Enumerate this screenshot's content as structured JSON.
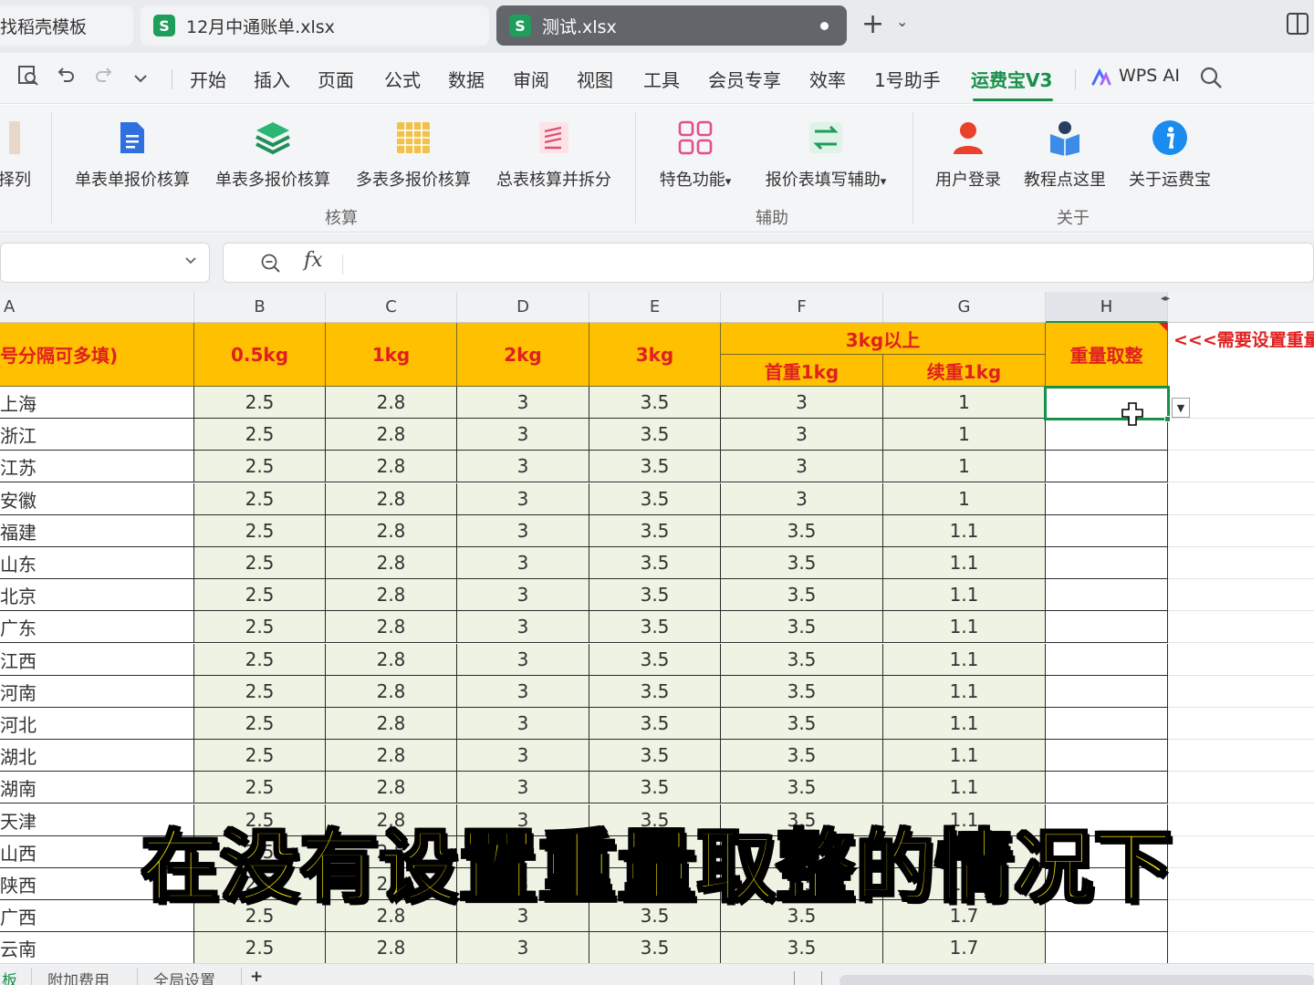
{
  "tabs": [
    {
      "label": "找稻壳模板",
      "icon": ""
    },
    {
      "label": "12月中通账单.xlsx",
      "icon": "S"
    },
    {
      "label": "测试.xlsx",
      "icon": "S"
    }
  ],
  "menu": [
    "开始",
    "插入",
    "页面",
    "公式",
    "数据",
    "审阅",
    "视图",
    "工具",
    "会员专享",
    "效率",
    "1号助手",
    "运费宝V3"
  ],
  "menu_active": "运费宝V3",
  "wps_ai": "WPS AI",
  "ribbon": {
    "left_cut": "择列",
    "buttons": [
      "单表单报价核算",
      "单表多报价核算",
      "多表多报价核算",
      "总表核算并拆分",
      "特色功能",
      "报价表填写辅助",
      "用户登录",
      "教程点这里",
      "关于运费宝"
    ],
    "dropdown_mark": "▾",
    "groups": [
      "核算",
      "辅助",
      "关于"
    ]
  },
  "formula_bar": {
    "fx": "fx",
    "namebox": "",
    "content": ""
  },
  "columns": [
    "A",
    "B",
    "C",
    "D",
    "E",
    "F",
    "G",
    "H"
  ],
  "header": {
    "a": "号分隔可多填)",
    "b": "0.5kg",
    "c": "1kg",
    "d": "2kg",
    "e": "3kg",
    "fg": "3kg以上",
    "f": "首重1kg",
    "g": "续重1kg",
    "h": "重量取整",
    "note": "<<<需要设置重量"
  },
  "rows": [
    [
      "上海",
      "2.5",
      "2.8",
      "3",
      "3.5",
      "3",
      "1"
    ],
    [
      "浙江",
      "2.5",
      "2.8",
      "3",
      "3.5",
      "3",
      "1"
    ],
    [
      "江苏",
      "2.5",
      "2.8",
      "3",
      "3.5",
      "3",
      "1"
    ],
    [
      "安徽",
      "2.5",
      "2.8",
      "3",
      "3.5",
      "3",
      "1"
    ],
    [
      "福建",
      "2.5",
      "2.8",
      "3",
      "3.5",
      "3.5",
      "1.1"
    ],
    [
      "山东",
      "2.5",
      "2.8",
      "3",
      "3.5",
      "3.5",
      "1.1"
    ],
    [
      "北京",
      "2.5",
      "2.8",
      "3",
      "3.5",
      "3.5",
      "1.1"
    ],
    [
      "广东",
      "2.5",
      "2.8",
      "3",
      "3.5",
      "3.5",
      "1.1"
    ],
    [
      "江西",
      "2.5",
      "2.8",
      "3",
      "3.5",
      "3.5",
      "1.1"
    ],
    [
      "河南",
      "2.5",
      "2.8",
      "3",
      "3.5",
      "3.5",
      "1.1"
    ],
    [
      "河北",
      "2.5",
      "2.8",
      "3",
      "3.5",
      "3.5",
      "1.1"
    ],
    [
      "湖北",
      "2.5",
      "2.8",
      "3",
      "3.5",
      "3.5",
      "1.1"
    ],
    [
      "湖南",
      "2.5",
      "2.8",
      "3",
      "3.5",
      "3.5",
      "1.1"
    ],
    [
      "天津",
      "2.5",
      "2.8",
      "3",
      "3.5",
      "3.5",
      "1.1"
    ],
    [
      "山西",
      "2.5",
      "2.8",
      "3",
      "3.5",
      "3.5",
      "1.1"
    ],
    [
      "陕西",
      "2.5",
      "2.8",
      "3",
      "3.5",
      "3.5",
      "1.1"
    ],
    [
      "广西",
      "2.5",
      "2.8",
      "3",
      "3.5",
      "3.5",
      "1.7"
    ],
    [
      "云南",
      "2.5",
      "2.8",
      "3",
      "3.5",
      "3.5",
      "1.7"
    ]
  ],
  "sheets": [
    "板",
    "附加费用",
    "全局设置",
    "+"
  ],
  "subtitle": "在没有设置重量取整的情况下",
  "colors": {
    "accent": "#17904a",
    "header_fill": "#ffc000",
    "header_text": "#e02020",
    "value_fill": "#eef3e4",
    "subtitle": "#f7e600"
  }
}
